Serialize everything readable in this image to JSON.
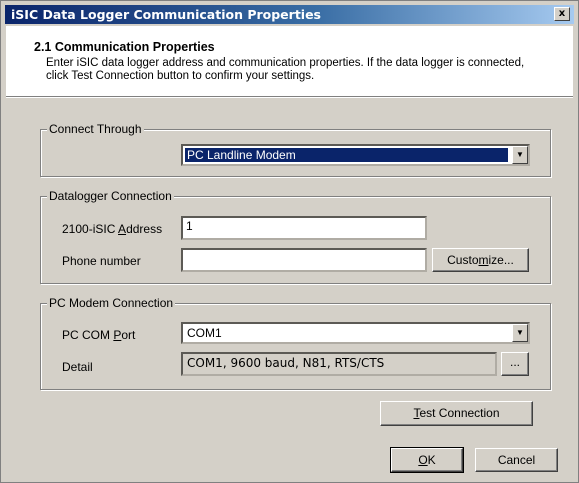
{
  "window": {
    "title": "iSIC Data Logger Communication Properties",
    "close_glyph": "x"
  },
  "header": {
    "title": "2.1 Communication Properties",
    "description": "Enter iSIC data logger address and communication properties. If the data logger is connected, click Test Connection button to confirm your settings."
  },
  "connect_through": {
    "legend": "Connect Through",
    "selected": "PC Landline Modem"
  },
  "datalogger_connection": {
    "legend": "Datalogger Connection",
    "address_label_pre": "2100-iSIC ",
    "address_label_u": "A",
    "address_label_post": "ddress",
    "address_value": "1",
    "phone_label": "Phone number",
    "phone_value": "",
    "customize_pre": "Custo",
    "customize_u": "m",
    "customize_post": "ize..."
  },
  "pc_modem_connection": {
    "legend": "PC Modem Connection",
    "com_label_pre": "PC COM ",
    "com_label_u": "P",
    "com_label_post": "ort",
    "com_value": "COM1",
    "detail_label": "Detail",
    "detail_value": "COM1, 9600 baud, N81, RTS/CTS",
    "detail_button": "..."
  },
  "buttons": {
    "test_u": "T",
    "test_post": "est Connection",
    "ok_u": "O",
    "ok_post": "K",
    "cancel": "Cancel"
  }
}
